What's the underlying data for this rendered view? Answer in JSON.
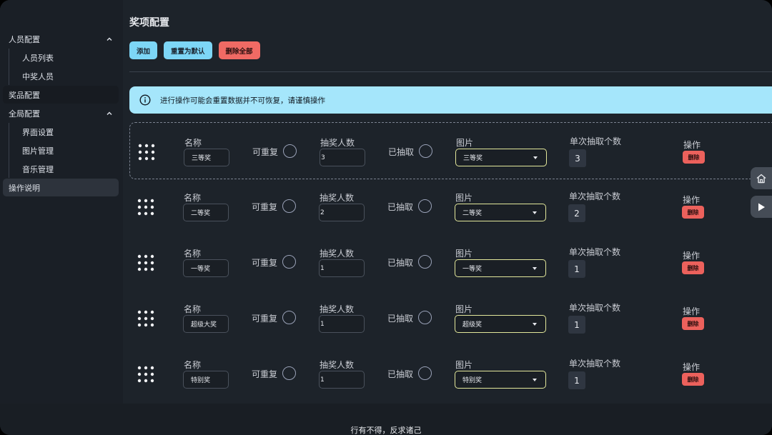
{
  "sidebar": {
    "groups": [
      {
        "title": "人员配置",
        "expanded": true,
        "items": [
          "人员列表",
          "中奖人员"
        ]
      },
      {
        "title": "奖品配置"
      },
      {
        "title": "全局配置",
        "expanded": true,
        "items": [
          "界面设置",
          "图片管理",
          "音乐管理"
        ]
      },
      {
        "title": "操作说明",
        "active": true
      }
    ]
  },
  "main": {
    "title": "奖项配置",
    "toolbar": {
      "add": "添加",
      "reset": "重置为默认",
      "delete_all": "删除全部"
    },
    "alert": "进行操作可能会重置数据并不可恢复，请谨慎操作",
    "labels": {
      "name": "名称",
      "repeatable": "可重复",
      "draw_count": "抽奖人数",
      "drawn": "已抽取",
      "image": "图片",
      "per_draw": "单次抽取个数",
      "actions": "操作",
      "delete": "删除"
    },
    "prizes": [
      {
        "name": "三等奖",
        "count": "3",
        "image": "三等奖",
        "per_draw": "3"
      },
      {
        "name": "二等奖",
        "count": "2",
        "image": "二等奖",
        "per_draw": "2"
      },
      {
        "name": "一等奖",
        "count": "1",
        "image": "一等奖",
        "per_draw": "1"
      },
      {
        "name": "超级大奖",
        "count": "1",
        "image": "超级奖",
        "per_draw": "1"
      },
      {
        "name": "特别奖",
        "count": "1",
        "image": "特别奖",
        "per_draw": "1"
      }
    ]
  },
  "footer": {
    "text": "行有不得，反求诸己"
  },
  "colors": {
    "accent_info": "#7dd6f6",
    "danger": "#f06a64",
    "alert_bg": "#a5e6fb",
    "background": "#1d232a"
  }
}
